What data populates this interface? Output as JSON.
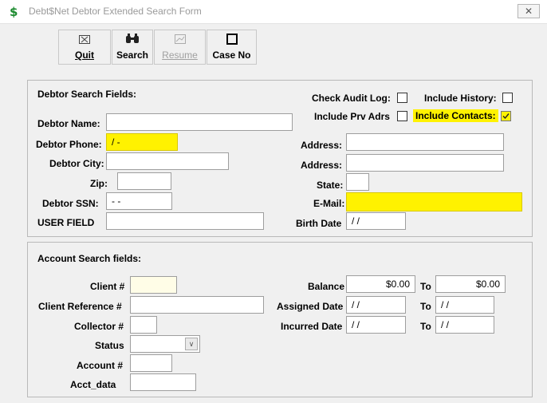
{
  "window": {
    "title": "Debt$Net  Debtor Extended Search Form",
    "close_label": "✕"
  },
  "toolbar": {
    "quit_label": "Quit",
    "search_label": "Search",
    "resume_label": "Resume",
    "caseno_label": "Case No"
  },
  "debtor": {
    "group_title": "Debtor Search Fields:",
    "check_audit_log_label": "Check Audit Log:",
    "include_history_label": "Include History:",
    "include_prv_adrs_label": "Include Prv Adrs",
    "include_contacts_label": "Include Contacts:",
    "include_contacts_checked": true,
    "name_label": "Debtor Name:",
    "phone_label": "Debtor Phone:",
    "phone_value": " /  -",
    "city_label": "Debtor City:",
    "zip_label": "Zip:",
    "ssn_label": "Debtor SSN:",
    "ssn_value": " -  -",
    "user_field_label": "USER FIELD",
    "address1_label": "Address:",
    "address2_label": "Address:",
    "state_label": "State:",
    "email_label": "E-Mail:",
    "birth_date_label": "Birth Date",
    "birth_date_value": " / /"
  },
  "account": {
    "group_title": "Account Search fields:",
    "client_label": "Client #",
    "client_ref_label": "Client Reference #",
    "collector_label": "Collector #",
    "status_label": "Status",
    "account_label": "Account #",
    "acct_data_label": "Acct_data",
    "balance_label": "Balance",
    "balance_from": "$0.00",
    "to_label": "To",
    "balance_to": "$0.00",
    "assigned_date_label": "Assigned Date",
    "assigned_from": " / /",
    "assigned_to": " / /",
    "incurred_date_label": "Incurred Date",
    "incurred_from": " / /",
    "incurred_to": " / /"
  }
}
